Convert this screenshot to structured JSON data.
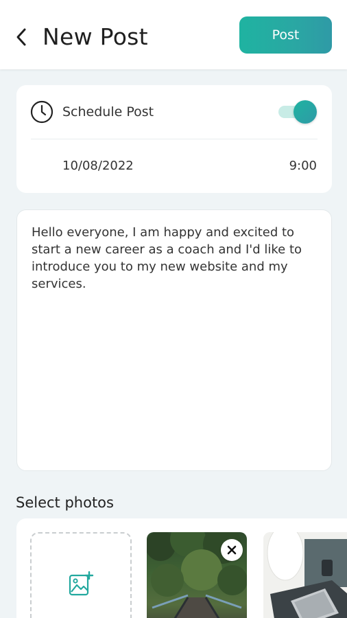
{
  "header": {
    "back_icon": "chevron-left-icon",
    "title": "New Post",
    "post_label": "Post"
  },
  "schedule": {
    "label": "Schedule Post",
    "icon": "clock-icon",
    "enabled": true,
    "date": "10/08/2022",
    "time": "9:00"
  },
  "post": {
    "text": "Hello everyone, I am happy and excited to start a new career as a coach and I'd like to introduce you to my new website and my services."
  },
  "photos": {
    "title": "Select photos",
    "add_icon": "add-image-icon",
    "items": [
      {
        "name": "forest-bridge-photo",
        "removable": true
      },
      {
        "name": "laptop-work-photo",
        "removable": false
      }
    ]
  },
  "colors": {
    "accent_start": "#1fb3a1",
    "accent_end": "#2f9aa6",
    "background": "#eff4f6",
    "card": "#ffffff"
  }
}
